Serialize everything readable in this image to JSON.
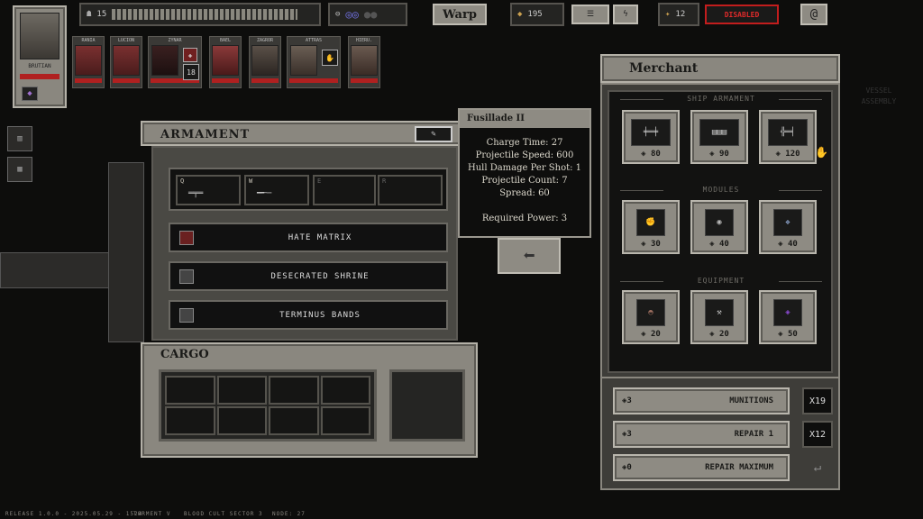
{
  "captain": {
    "name": "BRUTIAN"
  },
  "topbar": {
    "crew_count": "15",
    "warp_label": "Warp",
    "scrap": "195",
    "fuel": "12",
    "disabled_label": "DISABLED"
  },
  "crew": [
    {
      "name": "RANIA"
    },
    {
      "name": "LUCION"
    },
    {
      "name": "ZYNAR"
    },
    {
      "name": "BAEL"
    },
    {
      "name": "ZAGROR"
    },
    {
      "name": "ATTRAS"
    },
    {
      "name": "HIERU."
    }
  ],
  "crew_badge": "18",
  "armament": {
    "title": "ARMAMENT",
    "slots": [
      {
        "key": "Q"
      },
      {
        "key": "W"
      },
      {
        "key": "E"
      },
      {
        "key": "R"
      }
    ],
    "modules": [
      {
        "label": "HATE MATRIX"
      },
      {
        "label": "DESECRATED SHRINE"
      },
      {
        "label": "TERMINUS BANDS"
      }
    ]
  },
  "cargo": {
    "title": "CARGO"
  },
  "tooltip": {
    "title": "Fusillade II",
    "lines": [
      "Charge Time: 27",
      "Projectile Speed: 600",
      "Hull Damage Per Shot: 1",
      "Projectile Count: 7",
      "Spread: 60",
      "",
      "Required Power: 3"
    ]
  },
  "bg_label": {
    "line1": "VESSEL",
    "line2": "ASSEMBLY"
  },
  "merchant": {
    "title": "Merchant",
    "sections": [
      {
        "title": "SHIP ARMAMENT",
        "items": [
          {
            "price": "80"
          },
          {
            "price": "90"
          },
          {
            "price": "120"
          }
        ]
      },
      {
        "title": "MODULES",
        "items": [
          {
            "price": "30"
          },
          {
            "price": "40"
          },
          {
            "price": "40"
          }
        ]
      },
      {
        "title": "EQUIPMENT",
        "items": [
          {
            "price": "20"
          },
          {
            "price": "20"
          },
          {
            "price": "50"
          }
        ]
      }
    ],
    "buy": [
      {
        "cost": "3",
        "label": "MUNITIONS",
        "qty": "X19"
      },
      {
        "cost": "3",
        "label": "REPAIR 1",
        "qty": "X12"
      },
      {
        "cost": "0",
        "label": "REPAIR MAXIMUM",
        "qty": ""
      }
    ]
  },
  "footer": {
    "release": "RELEASE 1.0.0 - 2025.05.29 - 1524",
    "torment": "TORMENT V",
    "sector": "BLOOD CULT SECTOR 3",
    "node": "NODE: 27"
  },
  "colors": {
    "accent_red": "#c21d1d",
    "metal": "#8a877f",
    "bg": "#0d0d0c"
  }
}
